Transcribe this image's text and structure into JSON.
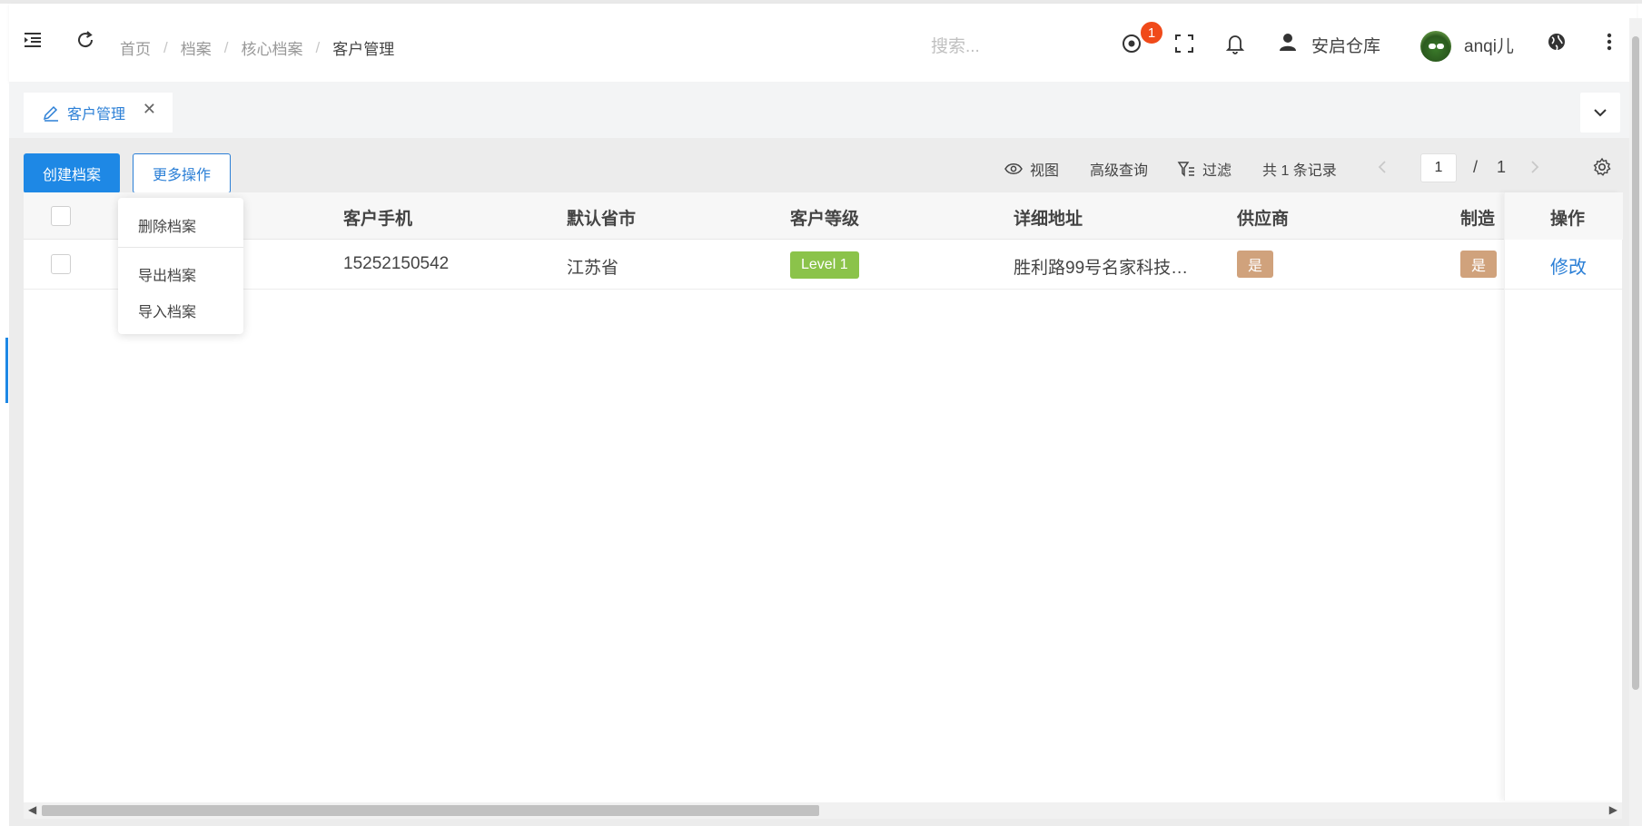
{
  "breadcrumb": [
    "首页",
    "档案",
    "核心档案",
    "客户管理"
  ],
  "search": {
    "placeholder": "搜索..."
  },
  "header": {
    "notification_badge": "1",
    "warehouse": "安启仓库",
    "username": "anqi儿"
  },
  "tabs": [
    {
      "label": "客户管理"
    }
  ],
  "toolbar": {
    "create": "创建档案",
    "more": "更多操作",
    "view": "视图",
    "advanced_query": "高级查询",
    "filter": "过滤",
    "total": "共 1 条记录",
    "page_current": "1",
    "page_sep": "/",
    "page_total": "1"
  },
  "dropdown": {
    "items": [
      "删除档案",
      "导出档案",
      "导入档案"
    ]
  },
  "table": {
    "columns": [
      "客户手机",
      "默认省市",
      "客户等级",
      "详细地址",
      "供应商",
      "制造",
      "操作"
    ],
    "rows": [
      {
        "phone": "15252150542",
        "province": "江苏省",
        "level": "Level 1",
        "address": "胜利路99号名家科技…",
        "supplier": "是",
        "manufacturer": "是",
        "action": "修改"
      }
    ]
  },
  "colors": {
    "primary": "#1e88e5",
    "link": "#2b7fd6",
    "level_tag": "#8bc34a",
    "yes_tag": "#d0a27c",
    "badge": "#f04a1a"
  },
  "icons": [
    "menu-indent-icon",
    "refresh-icon",
    "target-icon",
    "fullscreen-icon",
    "bell-icon",
    "user-icon",
    "avatar",
    "globe-icon",
    "more-vertical-icon",
    "edit-pen-icon",
    "close-icon",
    "chevron-down-icon",
    "eye-icon",
    "filter-icon",
    "chevron-left-icon",
    "chevron-right-icon",
    "gear-icon"
  ]
}
